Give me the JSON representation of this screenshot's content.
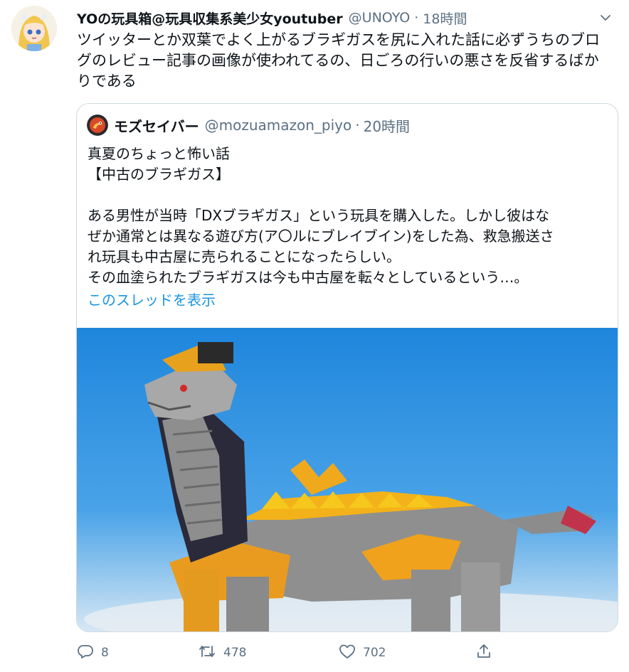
{
  "tweet": {
    "display_name": "YOの玩具箱@玩具収集系美少女youtuber",
    "handle": "@UNOYO",
    "separator": "·",
    "time": "18時間",
    "text": "ツイッターとか双葉でよく上がるブラギガスを尻に入れた話に必ずうちのブログのレビュー記事の画像が使われてるの、日ごろの行いの悪さを反省するばかりである"
  },
  "quote": {
    "display_name": "モズセイバー",
    "handle": "@mozuamazon_piyo",
    "separator": "·",
    "time": "20時間",
    "lines": [
      "真夏のちょっと怖い話",
      "【中古のブラギガス】",
      "",
      "ある男性が当時「DXブラギガス」という玩具を購入した。しかし彼はな",
      "ぜか通常とは異なる遊び方(ア〇ルにブレイブイン)をした為、救急搬送さ",
      "れ玩具も中古屋に売られることになったらしい。",
      "その血塗られたブラギガスは今も中古屋を転々としているという…。"
    ],
    "show_thread": "このスレッドを表示"
  },
  "actions": {
    "reply_count": "8",
    "retweet_count": "478",
    "like_count": "702"
  },
  "icons": {
    "reply": "reply-icon",
    "retweet": "retweet-icon",
    "like": "heart-icon",
    "share": "share-icon",
    "menu": "chevron-down-icon"
  },
  "colors": {
    "text": "#0f1419",
    "secondary": "#5b7083",
    "link": "#1b95e0",
    "border": "#cfd9de",
    "media_sky": "#2f8fdf"
  }
}
